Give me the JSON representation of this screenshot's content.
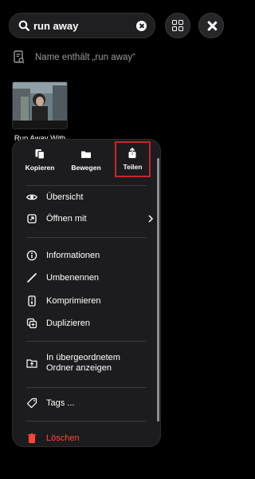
{
  "search": {
    "query": "run away"
  },
  "filter": {
    "text": "Name enthält „run away“"
  },
  "result": {
    "title": "Run Away With M..."
  },
  "menu": {
    "quick_actions": [
      {
        "label": "Kopieren"
      },
      {
        "label": "Bewegen"
      },
      {
        "label": "Teilen"
      }
    ],
    "items": [
      {
        "label": "Übersicht"
      },
      {
        "label": "Öffnen mit"
      },
      {
        "label": "Informationen"
      },
      {
        "label": "Umbenennen"
      },
      {
        "label": "Komprimieren"
      },
      {
        "label": "Duplizieren"
      },
      {
        "label": "In übergeordnetem Ordner anzeigen"
      },
      {
        "label": "Tags ..."
      },
      {
        "label": "Löschen"
      }
    ]
  },
  "colors": {
    "highlight": "#c62828",
    "danger": "#ff453a",
    "background": "#000000",
    "menu_bg": "#1c1c1e"
  }
}
